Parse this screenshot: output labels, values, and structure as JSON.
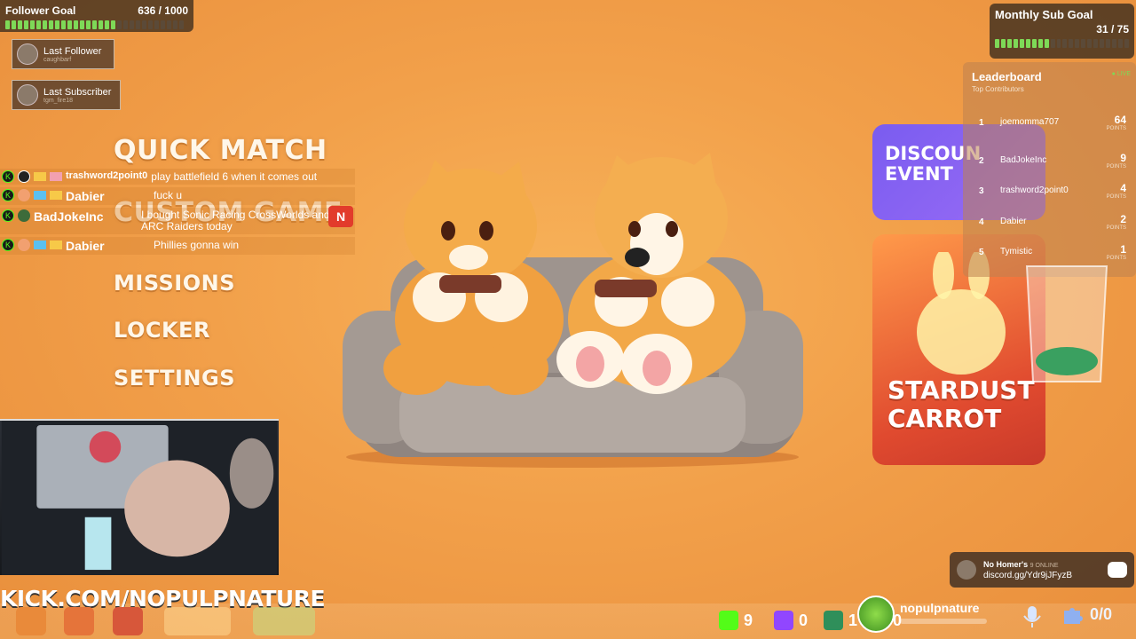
{
  "follower_goal": {
    "label": "Follower Goal",
    "count": "636 / 1000",
    "progress": 0.636
  },
  "last_follower": {
    "label": "Last Follower",
    "name": "caughbarf"
  },
  "last_subscriber": {
    "label": "Last Subscriber",
    "name": "tgm_fire18"
  },
  "menu": {
    "quick_match": "QUICK MATCH",
    "custom_game": "CUSTOM GAME",
    "missions": "MISSIONS",
    "locker": "LOCKER",
    "settings": "SETTINGS"
  },
  "chat": [
    {
      "user": "trashword2point0",
      "message": "play battlefield 6 when it comes out"
    },
    {
      "user": "Dabier",
      "message": "fuck u"
    },
    {
      "user": "BadJokeInc",
      "message": "I bought Sonic Racing CrossWorlds and ARC Raiders today"
    },
    {
      "user": "Dabier",
      "message": "Phillies gonna win"
    }
  ],
  "chat_badge_n": "N",
  "sub_goal": {
    "title": "Monthly Sub Goal",
    "count": "31 / 75",
    "progress": 0.413
  },
  "leaderboard": {
    "title": "Leaderboard",
    "subtitle": "Top Contributors",
    "live": "● LIVE",
    "points_label": "POINTS",
    "rows": [
      {
        "rank": "1",
        "name": "joemomma707",
        "points": "64"
      },
      {
        "rank": "2",
        "name": "BadJokeInc",
        "points": "9"
      },
      {
        "rank": "3",
        "name": "trashword2point0",
        "points": "4"
      },
      {
        "rank": "4",
        "name": "Dabier",
        "points": "2"
      },
      {
        "rank": "5",
        "name": "Tymistic",
        "points": "1"
      }
    ]
  },
  "cards": {
    "discount_line1": "DISCOUN",
    "discount_line2": "EVENT",
    "stardust_line1": "STARDUST",
    "stardust_line2": "CARROT"
  },
  "kick_url": "KICK.COM/NOPULPNATURE",
  "stats": {
    "kick": "9",
    "twitch": "0",
    "other": "1",
    "youtube": "0"
  },
  "channel_name": "nopulpnature",
  "discord": {
    "server": "No Homer's",
    "online": "9 ONLINE",
    "link": "discord.gg/Ydr9jJFyzB"
  },
  "viewers": "0/0",
  "colors": {
    "kick_green": "#53fc18",
    "twitch_purple": "#9146ff",
    "youtube_red": "#ff0000",
    "bg_orange": "#f2a04a"
  }
}
